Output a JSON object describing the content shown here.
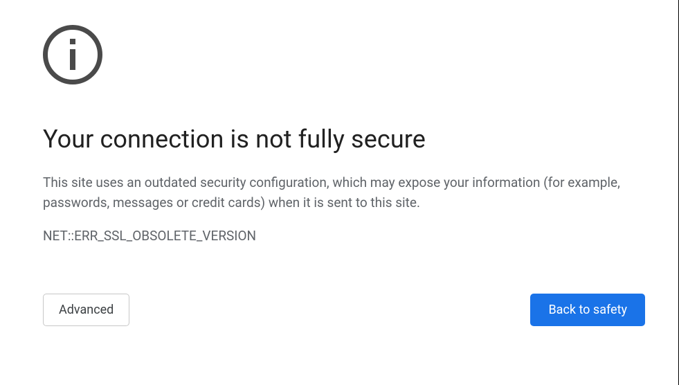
{
  "icon": {
    "name": "info-icon"
  },
  "heading": "Your connection is not fully secure",
  "description": "This site uses an outdated security configuration, which may expose your information (for example, passwords, messages or credit cards) when it is sent to this site.",
  "error_code": "NET::ERR_SSL_OBSOLETE_VERSION",
  "buttons": {
    "advanced_label": "Advanced",
    "back_label": "Back to safety"
  }
}
